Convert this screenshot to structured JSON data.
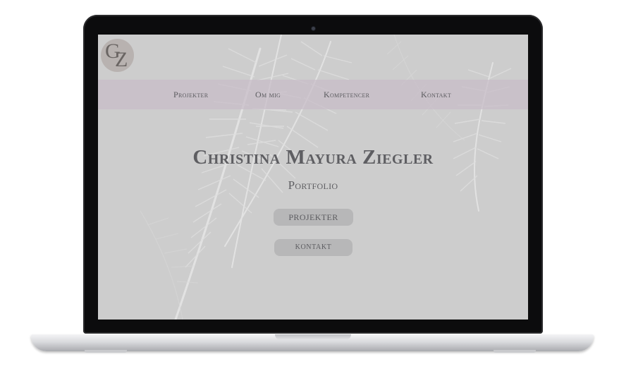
{
  "site": {
    "logo": {
      "letter_top": "G",
      "letter_bottom": "Z"
    },
    "nav": [
      {
        "label": "Projekter"
      },
      {
        "label": "Om mig"
      },
      {
        "label": "Kompetencer"
      },
      {
        "label": "Kontakt"
      }
    ],
    "hero": {
      "title": "Christina Mayura Ziegler",
      "subtitle": "Portfolio"
    },
    "buttons": {
      "projects_label": "PROJEKTER",
      "contact_label": "KONTAKT"
    }
  },
  "colors": {
    "nav_band": "#c8bcc8",
    "page_background": "#cfcfcf",
    "button": "#b7b7b8",
    "text": "#5e5e62",
    "logo_circle": "#b8b2b0"
  },
  "icons": [
    "camera-icon",
    "palm-leaves-background"
  ]
}
